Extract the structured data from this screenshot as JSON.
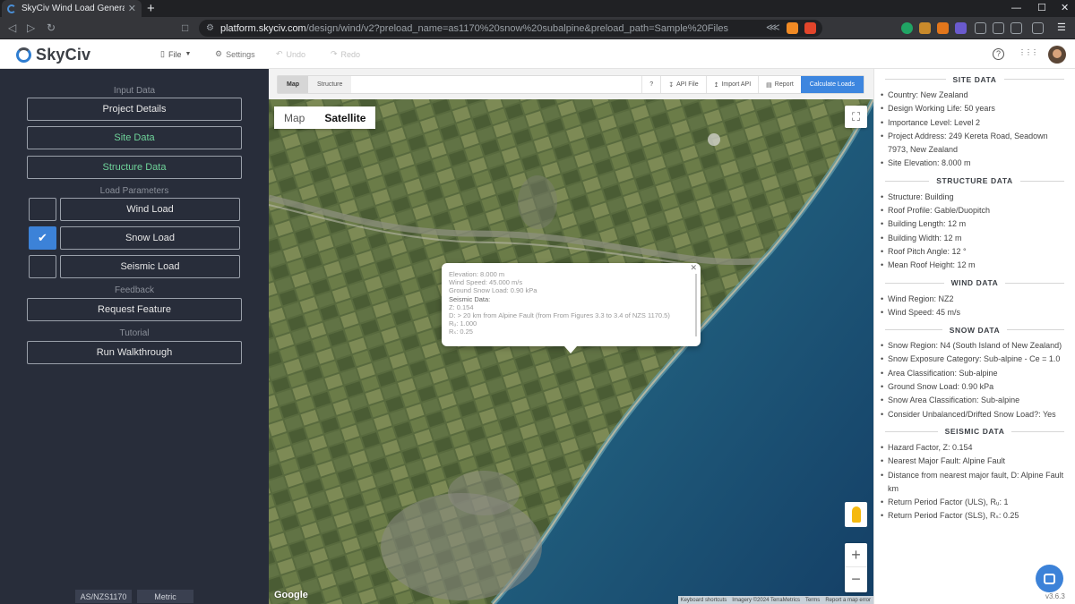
{
  "browser": {
    "tab_title": "SkyCiv Wind Load Generat",
    "tab_close": "✕",
    "new_tab": "+",
    "url_host": "platform.skyciv.com",
    "url_path": "/design/wind/v2?preload_name=as1170%20snow%20subalpine&preload_path=Sample%20Files",
    "win_min": "—",
    "win_max": "☐",
    "win_close": "✕"
  },
  "header": {
    "logo": "SkyCiv",
    "menu_file": "File",
    "menu_settings": "Settings",
    "menu_undo": "Undo",
    "menu_redo": "Redo",
    "help_icon": "?",
    "apps_icon": "⋮⋮⋮"
  },
  "sidebar": {
    "input_data_label": "Input Data",
    "project_details": "Project Details",
    "site_data": "Site Data",
    "structure_data": "Structure Data",
    "load_parameters_label": "Load Parameters",
    "wind_load": "Wind Load",
    "wind_load_checked": false,
    "snow_load": "Snow Load",
    "snow_load_checked": true,
    "seismic_load": "Seismic Load",
    "seismic_load_checked": false,
    "feedback_label": "Feedback",
    "request_feature": "Request Feature",
    "tutorial_label": "Tutorial",
    "run_walkthrough": "Run Walkthrough",
    "standard": "AS/NZS1170",
    "units": "Metric",
    "check_mark": "✔"
  },
  "toolbar": {
    "tab_map": "Map",
    "tab_structure": "Structure",
    "help": "?",
    "api_file": "API File",
    "import_api": "Import API",
    "report": "Report",
    "calculate": "Calculate Loads"
  },
  "map": {
    "type_map": "Map",
    "type_satellite": "Satellite",
    "fullscreen": "⛶",
    "zoom_in": "+",
    "zoom_out": "−",
    "google": "Google",
    "attribution": [
      "Keyboard shortcuts",
      "Imagery ©2024 TerraMetrics",
      "Terms",
      "Report a map error"
    ],
    "info_close": "✕",
    "info_lines": [
      "Elevation: 8.000 m",
      "Wind Speed: 45.000 m/s",
      "Ground Snow Load: 0.90 kPa",
      "Seismic Data:",
      "Z: 0.154",
      "D: > 20 km from Alpine Fault (from From Figures 3.3 to 3.4 of NZS 1170.5)",
      "Rᵤ: 1.000",
      "Rₛ: 0.25"
    ]
  },
  "right_panel": {
    "site_data": {
      "heading": "SITE DATA",
      "items": [
        "Country: New Zealand",
        "Design Working Life: 50 years",
        "Importance Level: Level 2",
        "Project Address: 249 Kereta Road, Seadown 7973, New Zealand",
        "Site Elevation: 8.000 m"
      ]
    },
    "structure_data": {
      "heading": "STRUCTURE DATA",
      "items": [
        "Structure: Building",
        "Roof Profile: Gable/Duopitch",
        "Building Length: 12 m",
        "Building Width: 12 m",
        "Roof Pitch Angle: 12 °",
        "Mean Roof Height: 12 m"
      ]
    },
    "wind_data": {
      "heading": "WIND DATA",
      "items": [
        "Wind Region: NZ2",
        "Wind Speed: 45 m/s"
      ]
    },
    "snow_data": {
      "heading": "SNOW DATA",
      "items": [
        "Snow Region: N4 (South Island of New Zealand)",
        "Snow Exposure Category: Sub-alpine - Ce = 1.0",
        "Area Classification: Sub-alpine",
        "Ground Snow Load: 0.90 kPa",
        "Snow Area Classification: Sub-alpine",
        "Consider Unbalanced/Drifted Snow Load?: Yes"
      ]
    },
    "seismic_data": {
      "heading": "SEISMIC DATA",
      "items": [
        "Hazard Factor, Z: 0.154",
        "Nearest Major Fault: Alpine Fault",
        "Distance from nearest major fault, D: Alpine Fault km",
        "Return Period Factor (ULS), Rᵤ: 1",
        "Return Period Factor (SLS), Rₛ: 0.25"
      ]
    },
    "version": "v3.6.3"
  },
  "colors": {
    "sidebar_bg": "#282d3a",
    "accent_blue": "#3c82d8",
    "accent_green": "#6fd39a"
  }
}
